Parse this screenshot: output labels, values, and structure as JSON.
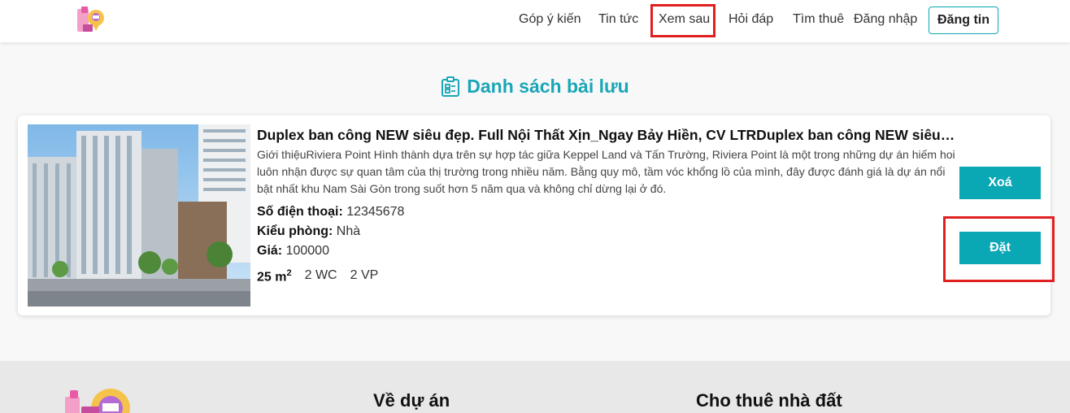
{
  "header": {
    "nav": [
      "Góp ý kiến",
      "Tin tức",
      "Xem sau",
      "Hỏi đáp",
      "Tìm thuê",
      "Đăng nhập"
    ],
    "post_button": "Đăng tin"
  },
  "page": {
    "title": "Danh sách bài lưu"
  },
  "listing": {
    "title": "Duplex ban công NEW siêu đẹp. Full Nội Thất Xịn_Ngay Bảy Hiền, CV LTRDuplex ban công NEW siêu đẹp...",
    "description": "Giới thiệuRiviera Point Hình thành dựa trên sự hợp tác giữa Keppel Land và Tấn Trường, Riviera Point là một trong những dự án hiếm hoi luôn nhận được sự quan tâm của thị trường trong nhiều năm. Bằng quy mô, tầm vóc khổng lồ của mình, đây được đánh giá là dự án nổi bật nhất khu Nam Sài Gòn trong suốt hơn 5 năm qua và không chỉ dừng lại ở đó.",
    "phone_label": "Số điện thoại:",
    "phone": "12345678",
    "room_type_label": "Kiểu phòng:",
    "room_type": "Nhà",
    "price_label": "Giá:",
    "price": "100000",
    "area": "25 m",
    "area_unit_sup": "2",
    "wc": "2 WC",
    "vp": "2 VP",
    "delete_button": "Xoá",
    "book_button": "Đặt"
  },
  "footer": {
    "col1_heading": "Về dự án",
    "col2_heading": "Cho thuê nhà đất"
  },
  "colors": {
    "accent": "#0aa7b5",
    "title": "#19a6b7",
    "highlight": "#e02020"
  }
}
